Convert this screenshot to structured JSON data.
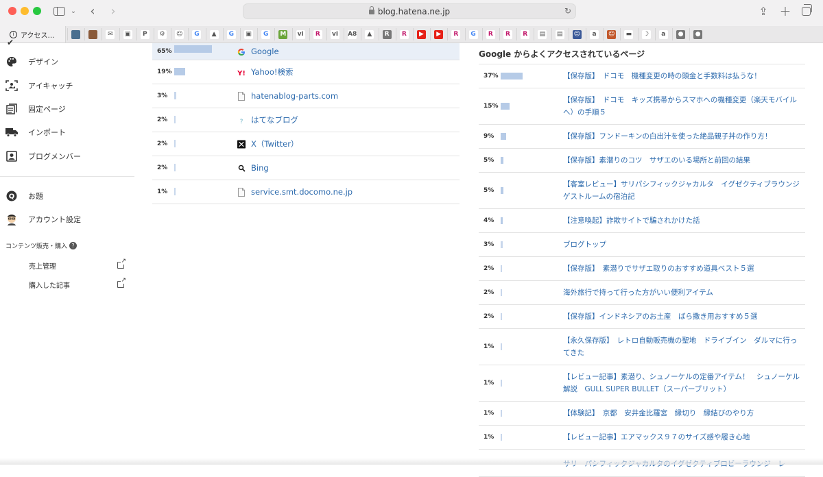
{
  "browser": {
    "url": "blog.hatena.ne.jp",
    "tab_label": "アクセス…",
    "favorites": [
      {
        "name": "fav-1",
        "color": "#4a6f8f",
        "glyph": ""
      },
      {
        "name": "fav-2",
        "color": "#8a5a3a",
        "glyph": ""
      },
      {
        "name": "fav-3",
        "color": "#ffffff",
        "glyph": "✉"
      },
      {
        "name": "fav-4",
        "color": "#ffffff",
        "glyph": "▣"
      },
      {
        "name": "fav-5",
        "color": "#ffffff",
        "glyph": "P"
      },
      {
        "name": "fav-6",
        "color": "#ffffff",
        "glyph": "⚙"
      },
      {
        "name": "fav-7",
        "color": "#ffffff",
        "glyph": "☺"
      },
      {
        "name": "fav-8",
        "color": "#ffffff",
        "glyph": "G"
      },
      {
        "name": "fav-9",
        "color": "#ffffff",
        "glyph": "▲"
      },
      {
        "name": "fav-10",
        "color": "#ffffff",
        "glyph": "G"
      },
      {
        "name": "fav-11",
        "color": "#ffffff",
        "glyph": "▣"
      },
      {
        "name": "fav-12",
        "color": "#ffffff",
        "glyph": "G"
      },
      {
        "name": "fav-13",
        "color": "#6ba539",
        "glyph": "M"
      },
      {
        "name": "fav-14",
        "color": "#ffffff",
        "glyph": "vi"
      },
      {
        "name": "fav-15",
        "color": "#ffffff",
        "glyph": "R"
      },
      {
        "name": "fav-16",
        "color": "#ffffff",
        "glyph": "vi"
      },
      {
        "name": "fav-17",
        "color": "#ffffff",
        "glyph": "A8"
      },
      {
        "name": "fav-18",
        "color": "#ffffff",
        "glyph": "▲"
      },
      {
        "name": "fav-19",
        "color": "#777777",
        "glyph": "R"
      },
      {
        "name": "fav-20",
        "color": "#ffffff",
        "glyph": "R"
      },
      {
        "name": "fav-21",
        "color": "#e62117",
        "glyph": "▶"
      },
      {
        "name": "fav-22",
        "color": "#e62117",
        "glyph": "▶"
      },
      {
        "name": "fav-23",
        "color": "#ffffff",
        "glyph": "R"
      },
      {
        "name": "fav-24",
        "color": "#ffffff",
        "glyph": "G"
      },
      {
        "name": "fav-25",
        "color": "#ffffff",
        "glyph": "R"
      },
      {
        "name": "fav-26",
        "color": "#ffffff",
        "glyph": "R"
      },
      {
        "name": "fav-27",
        "color": "#ffffff",
        "glyph": "R"
      },
      {
        "name": "fav-28",
        "color": "#ffffff",
        "glyph": "▤"
      },
      {
        "name": "fav-29",
        "color": "#ffffff",
        "glyph": "▤"
      },
      {
        "name": "fav-30",
        "color": "#3b5998",
        "glyph": "☺"
      },
      {
        "name": "fav-31",
        "color": "#ffffff",
        "glyph": "a"
      },
      {
        "name": "fav-32",
        "color": "#c2582c",
        "glyph": "☺"
      },
      {
        "name": "fav-33",
        "color": "#ffffff",
        "glyph": "▬"
      },
      {
        "name": "fav-34",
        "color": "#ffffff",
        "glyph": "☽"
      },
      {
        "name": "fav-35",
        "color": "#ffffff",
        "glyph": "a"
      },
      {
        "name": "fav-36",
        "color": "#777777",
        "glyph": "●"
      },
      {
        "name": "fav-37",
        "color": "#777777",
        "glyph": "●"
      }
    ]
  },
  "nav": {
    "items": [
      {
        "label": "デザイン"
      },
      {
        "label": "アイキャッチ"
      },
      {
        "label": "固定ページ"
      },
      {
        "label": "インポート"
      },
      {
        "label": "ブログメンバー"
      },
      {
        "label": "お題"
      },
      {
        "label": "アカウント設定"
      }
    ],
    "section_title": "コンテンツ販売・購入",
    "sub_items": [
      {
        "label": "売上管理"
      },
      {
        "label": "購入した記事"
      }
    ]
  },
  "referrers": [
    {
      "percent": "65%",
      "value": 65,
      "name": "Google",
      "icon": "google-icon"
    },
    {
      "percent": "19%",
      "value": 19,
      "name": "Yahoo!検索",
      "icon": "yahoo-icon"
    },
    {
      "percent": "3%",
      "value": 3,
      "name": "hatenablog-parts.com",
      "icon": "page-icon"
    },
    {
      "percent": "2%",
      "value": 2,
      "name": "はてなブログ",
      "icon": "hatena-icon"
    },
    {
      "percent": "2%",
      "value": 2,
      "name": "X（Twitter）",
      "icon": "x-icon"
    },
    {
      "percent": "2%",
      "value": 2,
      "name": "Bing",
      "icon": "search-icon"
    },
    {
      "percent": "1%",
      "value": 1,
      "name": "service.smt.docomo.ne.jp",
      "icon": "page-icon"
    }
  ],
  "google_pages": {
    "title": "Google からよくアクセスされているページ",
    "items": [
      {
        "percent": "37%",
        "value": 37,
        "title": "【保存版】　ドコモ　機種変更の時の頭金と手数料は払うな！"
      },
      {
        "percent": "15%",
        "value": 15,
        "title": "【保存版】　ドコモ　キッズ携帯からスマホへの機種変更（楽天モバイルへ）の手順５"
      },
      {
        "percent": "9%",
        "value": 9,
        "title": "【保存版】フンドーキンの白出汁を使った絶品親子丼の作り方！"
      },
      {
        "percent": "5%",
        "value": 5,
        "title": "【保存版】素潜りのコツ　サザエのいる場所と前回の結果"
      },
      {
        "percent": "5%",
        "value": 5,
        "title": "【客室レビュー】サリパシフィックジャカルタ　イグゼクティブラウンジゲストルームの宿泊記"
      },
      {
        "percent": "4%",
        "value": 4,
        "title": "【注意喚起】詐欺サイトで騙されかけた話"
      },
      {
        "percent": "3%",
        "value": 3,
        "title": "ブログトップ"
      },
      {
        "percent": "2%",
        "value": 2,
        "title": "【保存版】　素潜りでサザエ取りのおすすめ道具ベスト５選"
      },
      {
        "percent": "2%",
        "value": 2,
        "title": "海外旅行で持って行った方がいい便利アイテム"
      },
      {
        "percent": "2%",
        "value": 2,
        "title": "【保存版】インドネシアのお土産　ばら撒き用おすすめ５選"
      },
      {
        "percent": "1%",
        "value": 1,
        "title": "【永久保存版】　レトロ自動販売機の聖地　ドライブイン　ダルマに行ってきた"
      },
      {
        "percent": "1%",
        "value": 1,
        "title": "【レビュー記事】素潜り、シュノーケルの定番アイテム！　シュノーケル解説　GULL SUPER BULLET（スーパーブリット）"
      },
      {
        "percent": "1%",
        "value": 1,
        "title": "【体験記】　京都　安井金比羅宮　縁切り　縁結びのやり方"
      },
      {
        "percent": "1%",
        "value": 1,
        "title": "【レビュー記事】エアマックス９７のサイズ感や履き心地"
      },
      {
        "percent": "",
        "value": 0,
        "title": "サリ　パシフィックジャカルタのイグゼクティブロビーラウンジ　レ"
      }
    ]
  },
  "colors": {
    "bar": "#b6cbe7",
    "link": "#2c6aad",
    "highlight_row": "#e9eff7"
  }
}
